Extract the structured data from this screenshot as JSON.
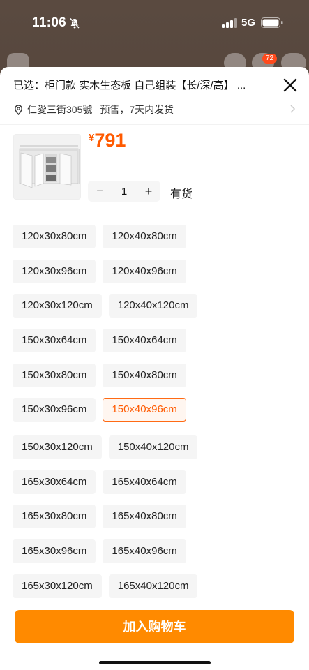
{
  "status_bar": {
    "time": "11:06",
    "network": "5G",
    "icons": [
      "bell-slash-icon",
      "signal-icon",
      "battery-icon"
    ]
  },
  "background_header": {
    "cart_badge": "72",
    "icons": [
      "back-icon",
      "share-icon",
      "cart-icon",
      "more-icon"
    ]
  },
  "sheet": {
    "selected_text": "已选：柜门款 实木生态板 自己组装【长/深/高】 ...",
    "location": "仁愛三街305號",
    "shipping": "预售，7天内发货",
    "price_symbol": "¥",
    "price_value": "791",
    "quantity": "1",
    "quantity_minus": "−",
    "quantity_plus": "+",
    "stock": "有货",
    "add_to_cart_label": "加入购物车"
  },
  "options": [
    [
      "120x30x80cm",
      "120x40x80cm"
    ],
    [
      "120x30x96cm",
      "120x40x96cm"
    ],
    [
      "120x30x120cm",
      "120x40x120cm"
    ],
    [
      "150x30x64cm",
      "150x40x64cm"
    ],
    [
      "150x30x80cm",
      "150x40x80cm"
    ],
    [
      "150x30x96cm",
      "150x40x96cm"
    ],
    [
      "150x30x120cm",
      "150x40x120cm"
    ],
    [
      "165x30x64cm",
      "165x40x64cm"
    ],
    [
      "165x30x80cm",
      "165x40x80cm"
    ],
    [
      "165x30x96cm",
      "165x40x96cm"
    ],
    [
      "165x30x120cm",
      "165x40x120cm"
    ]
  ],
  "selected_option": "150x40x96cm",
  "colors": {
    "accent": "#ff5a00",
    "button": "#ff8a00",
    "chip_bg": "#f5f5f5"
  }
}
